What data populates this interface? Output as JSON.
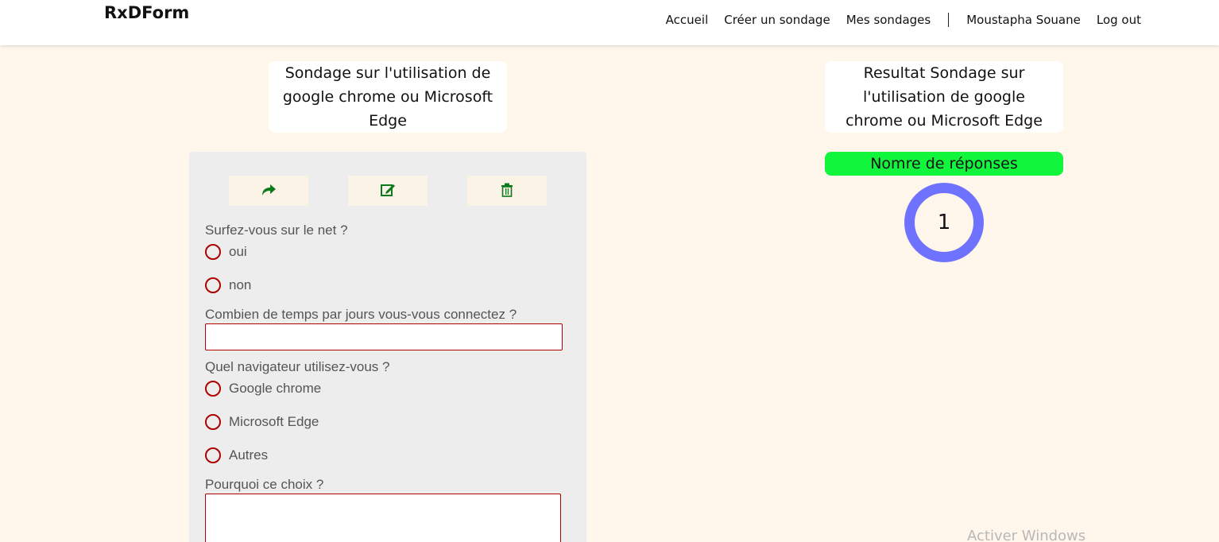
{
  "nav": {
    "brand": "RxDForm",
    "links": [
      "Accueil",
      "Créer un sondage",
      "Mes sondages"
    ],
    "user": "Moustapha Souane",
    "logout": "Log out"
  },
  "survey": {
    "title": "Sondage sur l'utilisation de google chrome ou Microsoft Edge",
    "questions": [
      {
        "label": "Surfez-vous sur le net ?",
        "options": [
          "oui",
          "non"
        ]
      },
      {
        "label": "Combien de temps par jours vous-vous connectez ?",
        "value": ""
      },
      {
        "label": "Quel navigateur utilisez-vous ?",
        "options": [
          "Google chrome",
          "Microsoft Edge",
          "Autres"
        ]
      },
      {
        "label": "Pourquoi ce choix ?",
        "value": ""
      }
    ]
  },
  "results": {
    "title": "Resultat Sondage sur l'utilisation de google chrome ou Microsoft Edge",
    "count_label": "Nomre de réponses",
    "count": "1"
  },
  "icons": {
    "share": "share-icon",
    "edit": "edit-icon",
    "delete": "trash-icon"
  },
  "colors": {
    "page_bg": "#fff6ec",
    "accent_green": "#11f53c",
    "ring": "#6f72ff",
    "radio_border": "#b00000",
    "icon_green": "#0a7a1a"
  },
  "watermark": "Activer Windows"
}
